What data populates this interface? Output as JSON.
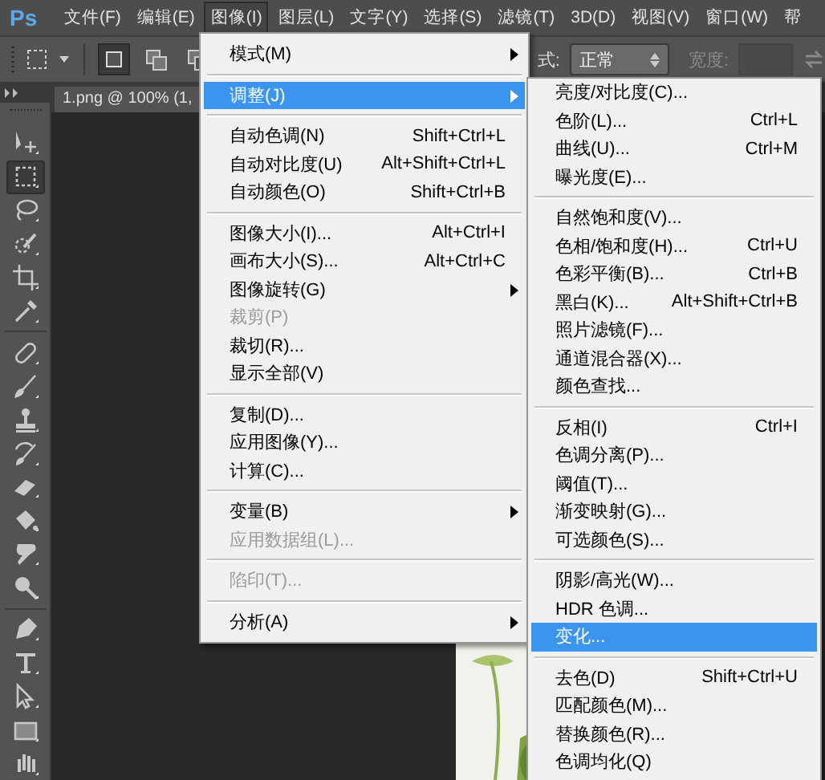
{
  "menubar": {
    "logo": "Ps",
    "items": [
      {
        "label": "文件(F)",
        "selected": false
      },
      {
        "label": "编辑(E)",
        "selected": false
      },
      {
        "label": "图像(I)",
        "selected": true
      },
      {
        "label": "图层(L)",
        "selected": false
      },
      {
        "label": "文字(Y)",
        "selected": false
      },
      {
        "label": "选择(S)",
        "selected": false
      },
      {
        "label": "滤镜(T)",
        "selected": false
      },
      {
        "label": "3D(D)",
        "selected": false
      },
      {
        "label": "视图(V)",
        "selected": false
      },
      {
        "label": "窗口(W)",
        "selected": false
      },
      {
        "label": "帮",
        "selected": false
      }
    ]
  },
  "options_bar": {
    "style_label": "式:",
    "style_value": "正常",
    "width_label": "宽度:"
  },
  "document_tab": {
    "title": "1.png @ 100% (1,"
  },
  "tools": [
    {
      "kind": "move",
      "selected": false
    },
    {
      "kind": "marquee",
      "selected": true
    },
    {
      "kind": "lasso",
      "selected": false
    },
    {
      "kind": "quick-select",
      "selected": false
    },
    {
      "kind": "crop",
      "selected": false
    },
    {
      "kind": "eyedropper",
      "selected": false
    },
    {
      "kind": "separator"
    },
    {
      "kind": "healing",
      "selected": false
    },
    {
      "kind": "brush",
      "selected": false
    },
    {
      "kind": "stamp",
      "selected": false
    },
    {
      "kind": "history-brush",
      "selected": false
    },
    {
      "kind": "eraser",
      "selected": false
    },
    {
      "kind": "bucket",
      "selected": false
    },
    {
      "kind": "smudge",
      "selected": false
    },
    {
      "kind": "dodge",
      "selected": false
    },
    {
      "kind": "separator"
    },
    {
      "kind": "pen",
      "selected": false
    },
    {
      "kind": "type",
      "selected": false
    },
    {
      "kind": "path-select",
      "selected": false
    },
    {
      "kind": "rectangle",
      "selected": false
    },
    {
      "kind": "hand",
      "selected": false
    }
  ],
  "image_menu": {
    "items": [
      {
        "kind": "item",
        "label": "模式(M)",
        "submenu": true,
        "disabled": false,
        "selected": false
      },
      {
        "kind": "separator"
      },
      {
        "kind": "item",
        "label": "调整(J)",
        "submenu": true,
        "disabled": false,
        "selected": true
      },
      {
        "kind": "separator"
      },
      {
        "kind": "item",
        "label": "自动色调(N)",
        "shortcut": "Shift+Ctrl+L",
        "submenu": false,
        "disabled": false,
        "selected": false
      },
      {
        "kind": "item",
        "label": "自动对比度(U)",
        "shortcut": "Alt+Shift+Ctrl+L",
        "submenu": false,
        "disabled": false,
        "selected": false
      },
      {
        "kind": "item",
        "label": "自动颜色(O)",
        "shortcut": "Shift+Ctrl+B",
        "submenu": false,
        "disabled": false,
        "selected": false
      },
      {
        "kind": "separator"
      },
      {
        "kind": "item",
        "label": "图像大小(I)...",
        "shortcut": "Alt+Ctrl+I",
        "submenu": false,
        "disabled": false,
        "selected": false
      },
      {
        "kind": "item",
        "label": "画布大小(S)...",
        "shortcut": "Alt+Ctrl+C",
        "submenu": false,
        "disabled": false,
        "selected": false
      },
      {
        "kind": "item",
        "label": "图像旋转(G)",
        "submenu": true,
        "disabled": false,
        "selected": false
      },
      {
        "kind": "item",
        "label": "裁剪(P)",
        "submenu": false,
        "disabled": true,
        "selected": false
      },
      {
        "kind": "item",
        "label": "裁切(R)...",
        "submenu": false,
        "disabled": false,
        "selected": false
      },
      {
        "kind": "item",
        "label": "显示全部(V)",
        "submenu": false,
        "disabled": false,
        "selected": false
      },
      {
        "kind": "separator"
      },
      {
        "kind": "item",
        "label": "复制(D)...",
        "submenu": false,
        "disabled": false,
        "selected": false
      },
      {
        "kind": "item",
        "label": "应用图像(Y)...",
        "submenu": false,
        "disabled": false,
        "selected": false
      },
      {
        "kind": "item",
        "label": "计算(C)...",
        "submenu": false,
        "disabled": false,
        "selected": false
      },
      {
        "kind": "separator"
      },
      {
        "kind": "item",
        "label": "变量(B)",
        "submenu": true,
        "disabled": false,
        "selected": false
      },
      {
        "kind": "item",
        "label": "应用数据组(L)...",
        "submenu": false,
        "disabled": true,
        "selected": false
      },
      {
        "kind": "separator"
      },
      {
        "kind": "item",
        "label": "陷印(T)...",
        "submenu": false,
        "disabled": true,
        "selected": false
      },
      {
        "kind": "separator"
      },
      {
        "kind": "item",
        "label": "分析(A)",
        "submenu": true,
        "disabled": false,
        "selected": false
      }
    ]
  },
  "adjust_menu": {
    "items": [
      {
        "kind": "item",
        "label": "亮度/对比度(C)...",
        "selected": false
      },
      {
        "kind": "item",
        "label": "色阶(L)...",
        "shortcut": "Ctrl+L",
        "selected": false
      },
      {
        "kind": "item",
        "label": "曲线(U)...",
        "shortcut": "Ctrl+M",
        "selected": false
      },
      {
        "kind": "item",
        "label": "曝光度(E)...",
        "selected": false
      },
      {
        "kind": "separator"
      },
      {
        "kind": "item",
        "label": "自然饱和度(V)...",
        "selected": false
      },
      {
        "kind": "item",
        "label": "色相/饱和度(H)...",
        "shortcut": "Ctrl+U",
        "selected": false
      },
      {
        "kind": "item",
        "label": "色彩平衡(B)...",
        "shortcut": "Ctrl+B",
        "selected": false
      },
      {
        "kind": "item",
        "label": "黑白(K)...",
        "shortcut": "Alt+Shift+Ctrl+B",
        "selected": false
      },
      {
        "kind": "item",
        "label": "照片滤镜(F)...",
        "selected": false
      },
      {
        "kind": "item",
        "label": "通道混合器(X)...",
        "selected": false
      },
      {
        "kind": "item",
        "label": "颜色查找...",
        "selected": false
      },
      {
        "kind": "separator"
      },
      {
        "kind": "item",
        "label": "反相(I)",
        "shortcut": "Ctrl+I",
        "selected": false
      },
      {
        "kind": "item",
        "label": "色调分离(P)...",
        "selected": false
      },
      {
        "kind": "item",
        "label": "阈值(T)...",
        "selected": false
      },
      {
        "kind": "item",
        "label": "渐变映射(G)...",
        "selected": false
      },
      {
        "kind": "item",
        "label": "可选颜色(S)...",
        "selected": false
      },
      {
        "kind": "separator"
      },
      {
        "kind": "item",
        "label": "阴影/高光(W)...",
        "selected": false
      },
      {
        "kind": "item",
        "label": "HDR 色调...",
        "selected": false
      },
      {
        "kind": "item",
        "label": "变化...",
        "selected": true
      },
      {
        "kind": "separator"
      },
      {
        "kind": "item",
        "label": "去色(D)",
        "shortcut": "Shift+Ctrl+U",
        "selected": false
      },
      {
        "kind": "item",
        "label": "匹配颜色(M)...",
        "selected": false
      },
      {
        "kind": "item",
        "label": "替换颜色(R)...",
        "selected": false
      },
      {
        "kind": "item",
        "label": "色调均化(Q)",
        "selected": false
      }
    ]
  }
}
